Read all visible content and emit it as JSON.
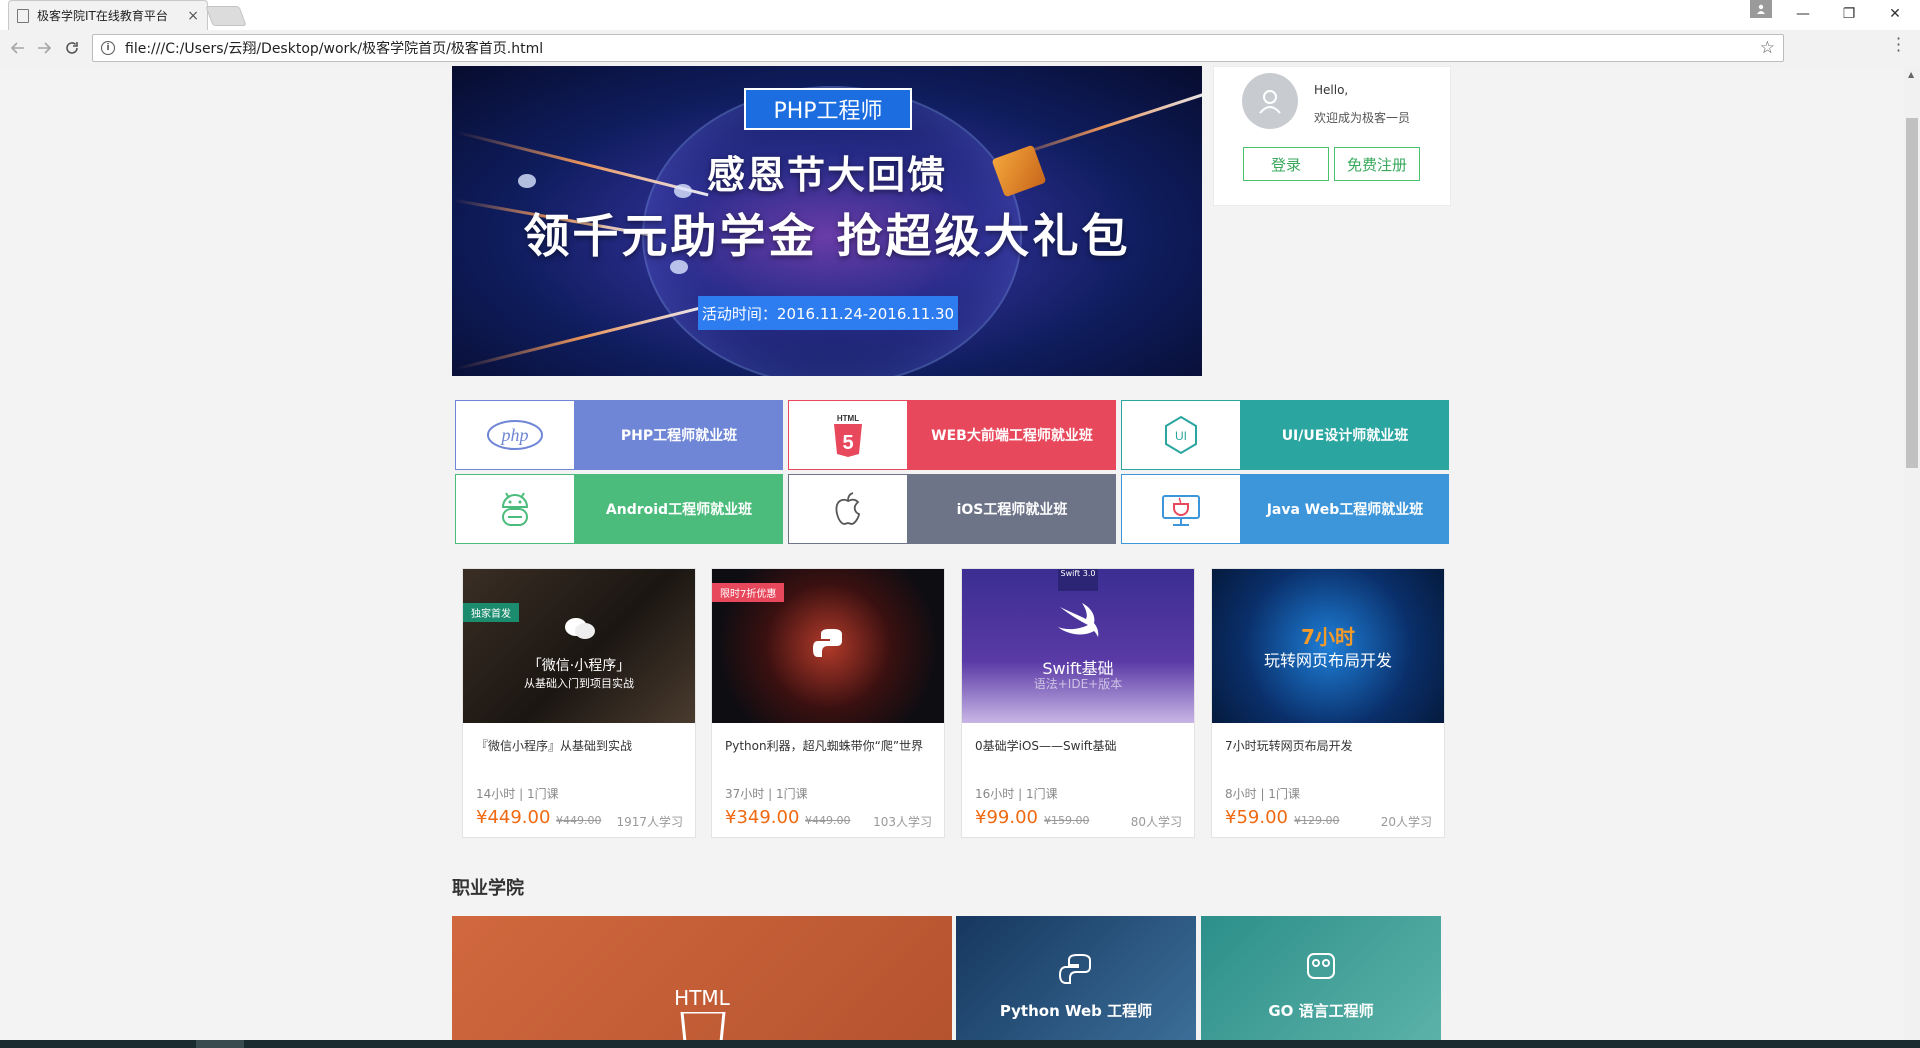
{
  "browser": {
    "tab_title": "极客学院IT在线教育平台",
    "tab_close": "×",
    "url": "file:///C:/Users/云翔/Desktop/work/极客学院首页/极客首页.html",
    "back_icon": "back-arrow-icon",
    "forward_icon": "forward-arrow-icon",
    "reload_icon": "reload-icon",
    "info": "i",
    "star": "☆",
    "minimize": "—",
    "maximize": "❐",
    "close": "✕",
    "user_glyph": "👤"
  },
  "banner": {
    "tag": "PHP工程师",
    "headline": "感恩节大回馈",
    "subheadline": "领千元助学金  抢超级大礼包",
    "time": "活动时间：2016.11.24-2016.11.30"
  },
  "user": {
    "hello": "Hello,",
    "welcome": "欢迎成为极客一员",
    "login": "登录",
    "register": "免费注册"
  },
  "courses": [
    {
      "label": "PHP工程师就业班",
      "icon": "php-icon",
      "icon_text": "php",
      "color": "#6f86d6"
    },
    {
      "label": "WEB大前端工程师就业班",
      "icon": "html5-icon",
      "icon_text": "5",
      "color": "#e8485c"
    },
    {
      "label": "UI/UE设计师就业班",
      "icon": "ui-icon",
      "icon_text": "UI",
      "color": "#2aa5a0"
    },
    {
      "label": "Android工程师就业班",
      "icon": "android-icon",
      "icon_text": "",
      "color": "#4cbc7c"
    },
    {
      "label": "iOS工程师就业班",
      "icon": "apple-icon",
      "icon_text": "",
      "color": "#6e7488"
    },
    {
      "label": "Java Web工程师就业班",
      "icon": "java-icon",
      "icon_text": "",
      "color": "#3d95da"
    }
  ],
  "cards": [
    {
      "title": "『微信小程序』从基础到实战",
      "meta": "14小时 | 1门课",
      "price": "¥449.00",
      "orig": "¥449.00",
      "students": "1917人学习",
      "thumb_title": "「微信·小程序」",
      "thumb_sub": "从基础入门到项目实战",
      "ribbon": "独家首发"
    },
    {
      "title": "Python利器，超凡蜘蛛带你“爬”世界",
      "meta": "37小时 | 1门课",
      "price": "¥349.00",
      "orig": "¥449.00",
      "students": "103人学习",
      "ribbon": "限时7折优惠"
    },
    {
      "title": "0基础学iOS——Swift基础",
      "meta": "16小时 | 1门课",
      "price": "¥99.00",
      "orig": "¥159.00",
      "students": "80人学习",
      "thumb_title": "Swift基础",
      "thumb_sub": "语法+IDE+版本",
      "badge": "Swift 3.0"
    },
    {
      "title": "7小时玩转网页布局开发",
      "meta": "8小时 | 1门课",
      "price": "¥59.00",
      "orig": "¥129.00",
      "students": "20人学习",
      "thumb_title": "7小时",
      "thumb_sub": "玩转网页布局开发"
    }
  ],
  "section_title": "职业学院",
  "career": [
    {
      "label": "HTML",
      "color": "#c8603a"
    },
    {
      "label": "Python Web 工程师",
      "color": "#1e4f7d"
    },
    {
      "label": "GO 语言工程师",
      "color": "#2c8f8a"
    }
  ]
}
